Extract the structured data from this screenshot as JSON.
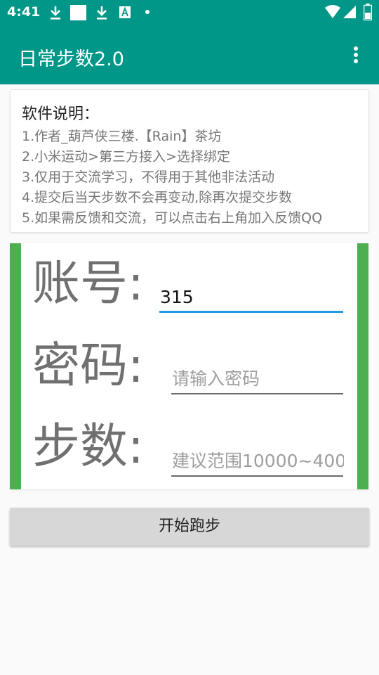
{
  "status_bar": {
    "time": "4:41",
    "icons": [
      "download-icon",
      "notification-square-icon",
      "download-icon",
      "font-icon",
      "dot-icon",
      "wifi-icon",
      "signal-icon",
      "battery-icon"
    ]
  },
  "app_bar": {
    "title": "日常步数2.0",
    "menu_icon": "more-vert-icon"
  },
  "info": {
    "heading": "软件说明：",
    "lines": [
      "1.作者_葫芦侠三楼.【Rain】茶坊",
      "2.小米运动>第三方接入>选择绑定",
      "3.仅用于交流学习，不得用于其他非法活动",
      "4.提交后当天步数不会再变动,除再次提交步数",
      "5.如果需反馈和交流，可以点击右上角加入反馈QQ"
    ]
  },
  "form": {
    "account": {
      "label": "账号:",
      "value": "315"
    },
    "password": {
      "label": "密码:",
      "placeholder": "请输入密码"
    },
    "steps": {
      "label": "步数:",
      "placeholder": "建议范围10000~400"
    }
  },
  "actions": {
    "start_label": "开始跑步"
  },
  "colors": {
    "primary": "#009688",
    "accent_bar": "#4caf50",
    "focus_line": "#1e9ce6",
    "button_bg": "#d7d7d7"
  }
}
